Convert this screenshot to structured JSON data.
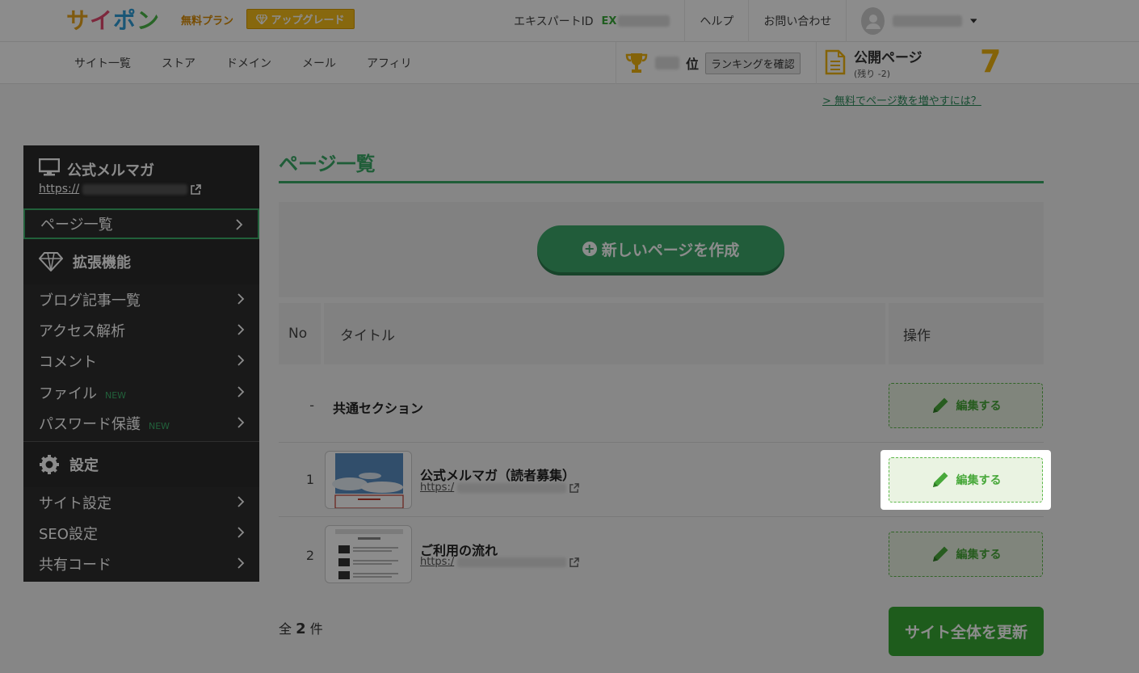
{
  "header": {
    "logo": {
      "ch1": "サ",
      "ch2": "イ",
      "ch3": "ポ",
      "ch4": "ン"
    },
    "plan_label": "無料プラン",
    "upgrade_label": "アップグレード",
    "expert_id_label": "エキスパートID",
    "expert_id_prefix": "EX",
    "help": "ヘルプ",
    "contact": "お問い合わせ"
  },
  "subnav": {
    "links": [
      "サイト一覧",
      "ストア",
      "ドメイン",
      "メール",
      "アフィリ"
    ],
    "rank_unit": "位",
    "rank_button": "ランキングを確認",
    "public_pages_title": "公開ページ",
    "public_pages_remaining": "(残り -2)",
    "public_pages_count": "7",
    "more_pages_link": "> 無料でページ数を増やすには？"
  },
  "sidebar": {
    "site_title": "公式メルマガ",
    "site_url_prefix": "https://",
    "page_list": "ページ一覧",
    "section_extensions": "拡張機能",
    "ext_items": [
      "ブログ記事一覧",
      "アクセス解析",
      "コメント",
      "ファイル",
      "パスワード保護"
    ],
    "new_badge": "NEW",
    "section_settings": "設定",
    "settings_items": [
      "サイト設定",
      "SEO設定",
      "共有コード"
    ]
  },
  "main": {
    "title": "ページ一覧",
    "create_button": "新しいページを作成",
    "columns": {
      "no": "No",
      "title": "タイトル",
      "ops": "操作"
    },
    "common_row": {
      "dash": "-",
      "title": "共通セクション",
      "edit": "編集する"
    },
    "rows": [
      {
        "no": "1",
        "title": "公式メルマガ（読者募集）",
        "url": "https:/",
        "edit": "編集する"
      },
      {
        "no": "2",
        "title": "ご利用の流れ",
        "url": "https:/",
        "edit": "編集する"
      }
    ],
    "total_prefix": "全",
    "total_count": "2",
    "total_suffix": "件",
    "update_button": "サイト全体を更新"
  },
  "colors": {
    "accent_green": "#39a966",
    "logo_orange": "#e8a41c",
    "upgrade_yellow": "#f6bd1a",
    "edit_green": "#48a83a",
    "sidebar_bg": "#2e2e2e"
  }
}
